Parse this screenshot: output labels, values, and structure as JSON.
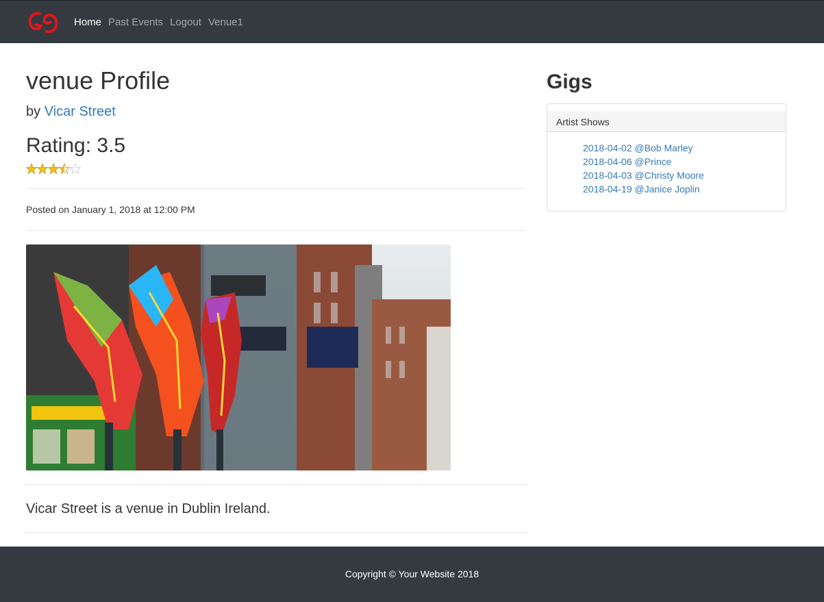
{
  "nav": {
    "brand_icon": "g9-logo-icon",
    "links": [
      {
        "label": "Home",
        "active": true
      },
      {
        "label": "Past Events",
        "active": false
      },
      {
        "label": "Logout",
        "active": false
      },
      {
        "label": "Venue1",
        "active": false
      }
    ]
  },
  "main": {
    "title": "venue Profile",
    "by_prefix": "by",
    "venue_name": "Vicar Street",
    "rating_text": "Rating: 3.5",
    "rating_value": 3.5,
    "rating_max": 5,
    "posted": "Posted on January 1, 2018 at 12:00 PM",
    "description": "Vicar Street is a venue in Dublin Ireland."
  },
  "sidebar": {
    "title": "Gigs",
    "card_header": "Artist Shows",
    "gigs": [
      "2018-04-02 @Bob Marley",
      "2018-04-06 @Prince",
      "2018-04-03 @Christy Moore",
      "2018-04-19 @Janice Joplin"
    ]
  },
  "footer": {
    "copyright": "Copyright © Your Website 2018"
  },
  "colors": {
    "navbar": "#343a40",
    "link": "#337ab7",
    "star": "#f0c419"
  }
}
